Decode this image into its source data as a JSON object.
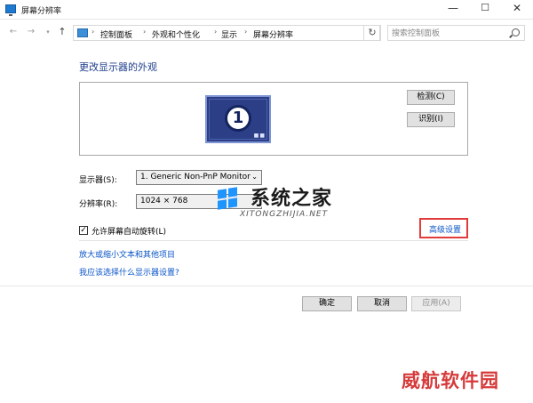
{
  "window": {
    "title": "屏幕分辨率",
    "minimize": "—",
    "maximize": "☐",
    "close": "✕"
  },
  "address": {
    "breadcrumbs": [
      "控制面板",
      "外观和个性化",
      "显示",
      "屏幕分辨率"
    ],
    "separator": "›",
    "search_placeholder": "搜索控制面板"
  },
  "main": {
    "title": "更改显示器的外观",
    "monitor_number": "1",
    "detect_label": "检测(C)",
    "identify_label": "识别(I)",
    "display_label": "显示器(S):",
    "display_value": "1. Generic Non-PnP Monitor",
    "resolution_label": "分辨率(R):",
    "resolution_value": "1024 × 768",
    "rotate_checked": "✓",
    "rotate_label": "允许屏幕自动旋转(L)",
    "advanced_link": "高级设置",
    "link_text_size": "放大或缩小文本和其他项目",
    "link_help": "我应该选择什么显示器设置?"
  },
  "footer": {
    "ok": "确定",
    "cancel": "取消",
    "apply": "应用(A)"
  },
  "watermark": {
    "title": "系统之家",
    "subtitle": "XITONGZHIJIA.NET",
    "corner": "威航软件园"
  },
  "colors": {
    "title_blue": "#1e3e8c",
    "link_blue": "#0a55c8",
    "highlight_red": "#e23b3b",
    "monitor_blue": "#2c3f86"
  }
}
